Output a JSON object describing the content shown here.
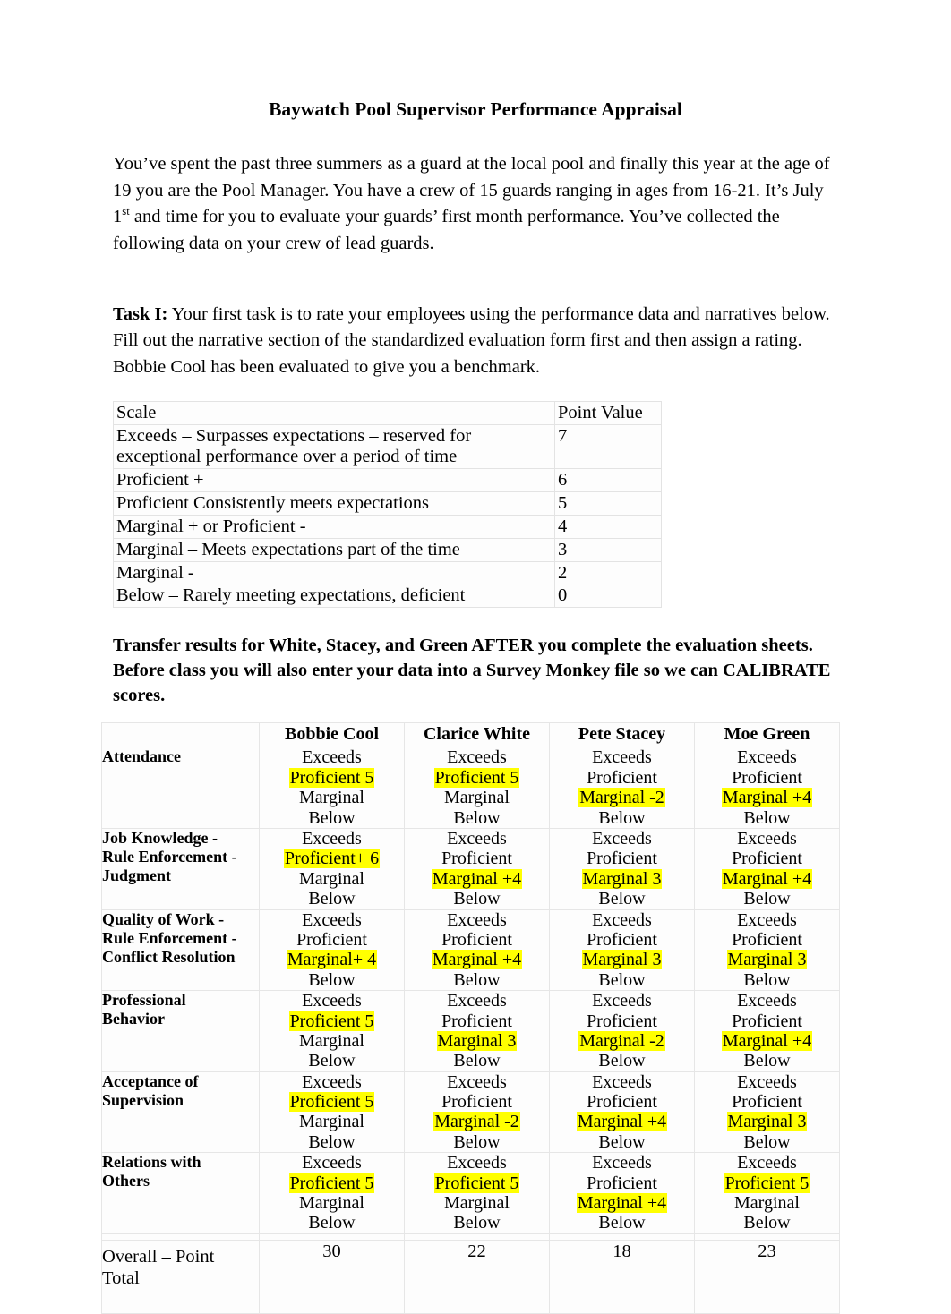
{
  "document": {
    "title": "Baywatch Pool Supervisor Performance Appraisal",
    "intro_paragraph_part1": "You’ve spent the past three summers as a guard at the local pool and finally this year at the age of 19 you are the Pool Manager. You have a crew of 15 guards ranging in ages from 16-21. It’s July 1",
    "intro_superscript": "st",
    "intro_paragraph_part2": " and time for you to evaluate your guards’ first month performance. You’ve collected the following data on your crew of lead guards.",
    "task_label": "Task I:",
    "task_paragraph": " Your first task is to rate your employees using the performance data and narratives below. Fill out the narrative section of the standardized evaluation form first and then assign a rating. Bobbie Cool has been evaluated to give you a benchmark.",
    "transfer_paragraph": "Transfer results for White, Stacey, and Green AFTER you complete the evaluation sheets. Before class you will also enter your data into a Survey Monkey file so we can CALIBRATE scores."
  },
  "scale_table": {
    "headers": [
      "Scale",
      "Point Value"
    ],
    "rows": [
      {
        "scale": "Exceeds – Surpasses expectations – reserved for exceptional performance over a period of time",
        "points": "7"
      },
      {
        "scale": "Proficient +",
        "points": "6"
      },
      {
        "scale": "Proficient    Consistently meets expectations",
        "points": "5"
      },
      {
        "scale": "Marginal + or Proficient -",
        "points": "4"
      },
      {
        "scale": "Marginal – Meets expectations part of the time",
        "points": "3"
      },
      {
        "scale": "Marginal -",
        "points": "2"
      },
      {
        "scale": "Below – Rarely meeting expectations, deficient",
        "points": "0"
      }
    ]
  },
  "appraisal_table": {
    "corner_label": "",
    "people": [
      "Bobbie Cool",
      "Clarice White",
      "Pete Stacey",
      "Moe Green"
    ],
    "rows": [
      {
        "label": "Attendance",
        "cells": [
          [
            {
              "t": "Exceeds",
              "h": false
            },
            {
              "t": "Proficient 5",
              "h": true
            },
            {
              "t": "Marginal",
              "h": false
            },
            {
              "t": "Below",
              "h": false
            }
          ],
          [
            {
              "t": "Exceeds",
              "h": false
            },
            {
              "t": "Proficient 5",
              "h": true
            },
            {
              "t": "Marginal",
              "h": false
            },
            {
              "t": "Below",
              "h": false
            }
          ],
          [
            {
              "t": "Exceeds",
              "h": false
            },
            {
              "t": "Proficient",
              "h": false
            },
            {
              "t": "Marginal -2",
              "h": true
            },
            {
              "t": "Below",
              "h": false
            }
          ],
          [
            {
              "t": "Exceeds",
              "h": false
            },
            {
              "t": "Proficient",
              "h": false
            },
            {
              "t": "Marginal +4",
              "h": true
            },
            {
              "t": "Below",
              "h": false
            }
          ]
        ]
      },
      {
        "label": " Job Knowledge -\nRule Enforcement -\nJudgment",
        "cells": [
          [
            {
              "t": "Exceeds",
              "h": false
            },
            {
              "t": "Proficient+ 6",
              "h": true
            },
            {
              "t": "Marginal",
              "h": false
            },
            {
              "t": "Below",
              "h": false
            }
          ],
          [
            {
              "t": "Exceeds",
              "h": false
            },
            {
              "t": "Proficient",
              "h": false
            },
            {
              "t": "Marginal +4",
              "h": true
            },
            {
              "t": "Below",
              "h": false
            }
          ],
          [
            {
              "t": "Exceeds",
              "h": false
            },
            {
              "t": "Proficient",
              "h": false
            },
            {
              "t": "Marginal 3",
              "h": true
            },
            {
              "t": "Below",
              "h": false
            }
          ],
          [
            {
              "t": "Exceeds",
              "h": false
            },
            {
              "t": "Proficient",
              "h": false
            },
            {
              "t": "Marginal +4",
              "h": true
            },
            {
              "t": "Below",
              "h": false
            }
          ]
        ]
      },
      {
        "label": "Quality of Work -\nRule Enforcement -\nConflict Resolution",
        "cells": [
          [
            {
              "t": "Exceeds",
              "h": false
            },
            {
              "t": "Proficient",
              "h": false
            },
            {
              "t": "Marginal+ 4",
              "h": true
            },
            {
              "t": "Below",
              "h": false
            }
          ],
          [
            {
              "t": "Exceeds",
              "h": false
            },
            {
              "t": "Proficient",
              "h": false
            },
            {
              "t": "Marginal +4",
              "h": true
            },
            {
              "t": "Below",
              "h": false
            }
          ],
          [
            {
              "t": "Exceeds",
              "h": false
            },
            {
              "t": "Proficient",
              "h": false
            },
            {
              "t": "Marginal 3",
              "h": true
            },
            {
              "t": "Below",
              "h": false
            }
          ],
          [
            {
              "t": "Exceeds",
              "h": false
            },
            {
              "t": "Proficient",
              "h": false
            },
            {
              "t": "Marginal 3",
              "h": true
            },
            {
              "t": "Below",
              "h": false
            }
          ]
        ]
      },
      {
        "label": "Professional\nBehavior",
        "cells": [
          [
            {
              "t": "Exceeds",
              "h": false
            },
            {
              "t": "Proficient 5",
              "h": true
            },
            {
              "t": "Marginal",
              "h": false
            },
            {
              "t": "Below",
              "h": false
            }
          ],
          [
            {
              "t": "Exceeds",
              "h": false
            },
            {
              "t": "Proficient",
              "h": false
            },
            {
              "t": "Marginal 3",
              "h": true
            },
            {
              "t": "Below",
              "h": false
            }
          ],
          [
            {
              "t": "Exceeds",
              "h": false
            },
            {
              "t": "Proficient",
              "h": false
            },
            {
              "t": "Marginal -2",
              "h": true
            },
            {
              "t": "Below",
              "h": false
            }
          ],
          [
            {
              "t": "Exceeds",
              "h": false
            },
            {
              "t": "Proficient",
              "h": false
            },
            {
              "t": "Marginal +4",
              "h": true
            },
            {
              "t": "Below",
              "h": false
            }
          ]
        ]
      },
      {
        "label": "Acceptance of\nSupervision",
        "cells": [
          [
            {
              "t": "Exceeds",
              "h": false
            },
            {
              "t": "Proficient 5",
              "h": true
            },
            {
              "t": "Marginal",
              "h": false
            },
            {
              "t": "Below",
              "h": false
            }
          ],
          [
            {
              "t": "Exceeds",
              "h": false
            },
            {
              "t": "Proficient",
              "h": false
            },
            {
              "t": "Marginal -2",
              "h": true
            },
            {
              "t": "Below",
              "h": false
            }
          ],
          [
            {
              "t": "Exceeds",
              "h": false
            },
            {
              "t": "Proficient",
              "h": false
            },
            {
              "t": "Marginal +4",
              "h": true
            },
            {
              "t": "Below",
              "h": false
            }
          ],
          [
            {
              "t": "Exceeds",
              "h": false
            },
            {
              "t": "Proficient",
              "h": false
            },
            {
              "t": "Marginal 3",
              "h": true
            },
            {
              "t": "Below",
              "h": false
            }
          ]
        ]
      },
      {
        "label": "Relations with\nOthers",
        "cells": [
          [
            {
              "t": "Exceeds",
              "h": false
            },
            {
              "t": "Proficient 5",
              "h": true
            },
            {
              "t": "Marginal",
              "h": false
            },
            {
              "t": "Below",
              "h": false
            }
          ],
          [
            {
              "t": "Exceeds",
              "h": false
            },
            {
              "t": "Proficient 5",
              "h": true
            },
            {
              "t": "Marginal",
              "h": false
            },
            {
              "t": "Below",
              "h": false
            }
          ],
          [
            {
              "t": "Exceeds",
              "h": false
            },
            {
              "t": "Proficient",
              "h": false
            },
            {
              "t": "Marginal +4",
              "h": true
            },
            {
              "t": "Below",
              "h": false
            }
          ],
          [
            {
              "t": "Exceeds",
              "h": false
            },
            {
              "t": "Proficient 5",
              "h": true
            },
            {
              "t": "Marginal",
              "h": false
            },
            {
              "t": "Below",
              "h": false
            }
          ]
        ]
      }
    ],
    "total_row": {
      "label": "Overall – Point Total",
      "values": [
        "30",
        "22",
        "18",
        "23"
      ]
    }
  },
  "colors": {
    "highlight": "#ffff00",
    "text": "#000000",
    "table_border": "#e6e6e6",
    "page_background": "#ffffff"
  }
}
